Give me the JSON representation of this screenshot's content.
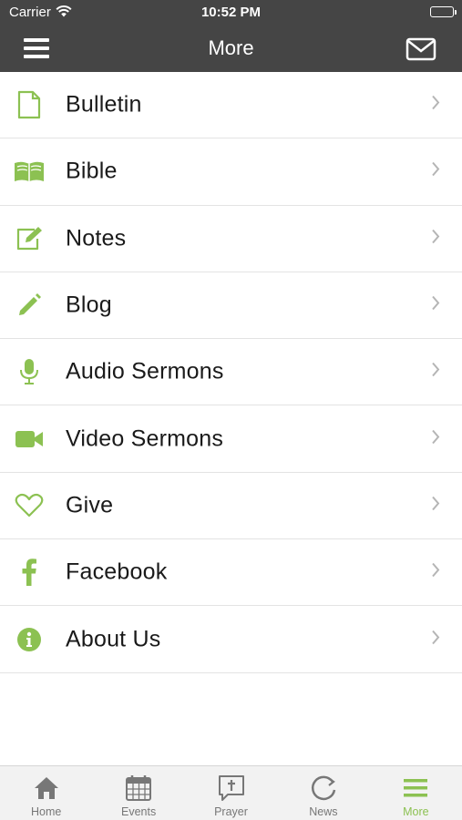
{
  "status_bar": {
    "carrier": "Carrier",
    "time": "10:52 PM"
  },
  "nav": {
    "title": "More"
  },
  "colors": {
    "accent": "#8cc152",
    "header_bg": "#454545",
    "tab_inactive": "#777777"
  },
  "menu": [
    {
      "label": "Bulletin",
      "icon": "document-icon"
    },
    {
      "label": "Bible",
      "icon": "book-open-icon"
    },
    {
      "label": "Notes",
      "icon": "edit-note-icon"
    },
    {
      "label": "Blog",
      "icon": "pencil-icon"
    },
    {
      "label": "Audio Sermons",
      "icon": "microphone-icon"
    },
    {
      "label": "Video Sermons",
      "icon": "video-camera-icon"
    },
    {
      "label": "Give",
      "icon": "heart-icon"
    },
    {
      "label": "Facebook",
      "icon": "facebook-icon"
    },
    {
      "label": "About Us",
      "icon": "info-icon"
    }
  ],
  "tabs": [
    {
      "label": "Home",
      "icon": "home-icon",
      "active": false
    },
    {
      "label": "Events",
      "icon": "calendar-icon",
      "active": false
    },
    {
      "label": "Prayer",
      "icon": "prayer-icon",
      "active": false
    },
    {
      "label": "News",
      "icon": "news-refresh-icon",
      "active": false
    },
    {
      "label": "More",
      "icon": "hamburger-icon",
      "active": true
    }
  ]
}
